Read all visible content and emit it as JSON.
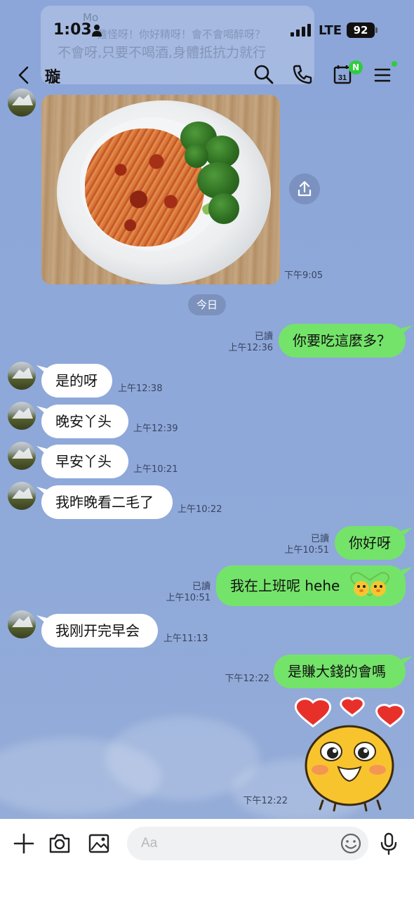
{
  "status_bar": {
    "time": "1:03",
    "network": "LTE",
    "battery": "92"
  },
  "notification_ghost": {
    "sender": "Mo",
    "line1": "難怪呀！你好精呀！會不會喝醉呀？",
    "line2": "不會呀,只要不喝酒,身體抵抗力就行"
  },
  "header": {
    "title": "璇",
    "calendar_day": "31",
    "calendar_badge": "N"
  },
  "photo_message": {
    "time": "下午9:05"
  },
  "date_divider": "今日",
  "messages": [
    {
      "side": "out",
      "text": "你要吃這麼多？",
      "read": "已讀",
      "time": "上午12:36"
    },
    {
      "side": "in",
      "text": "是的呀",
      "time": "上午12:38"
    },
    {
      "side": "in",
      "text": "晚安丫头",
      "time": "上午12:39"
    },
    {
      "side": "in",
      "text": "早安丫头",
      "time": "上午10:21"
    },
    {
      "side": "in",
      "text": "我昨晚看二毛了",
      "time": "上午10:22"
    },
    {
      "side": "out",
      "text": "你好呀",
      "read": "已讀",
      "time": "上午10:51"
    },
    {
      "side": "out",
      "text": "我在上班呢 hehe",
      "read": "已讀",
      "time": "上午10:51"
    },
    {
      "side": "in",
      "text": "我刚开完早会",
      "time": "上午11:13"
    },
    {
      "side": "out",
      "text": "是賺大錢的會嗎",
      "time": "下午12:22"
    }
  ],
  "sticker_message": {
    "time": "下午12:22"
  },
  "input": {
    "placeholder": "Aa",
    "value": ""
  },
  "colors": {
    "chat_bg": "#8fa8d8",
    "outgoing_bubble": "#74e36a",
    "incoming_bubble": "#ffffff",
    "badge_green": "#2ecc40"
  },
  "icons": [
    "back-icon",
    "search-icon",
    "phone-icon",
    "calendar-icon",
    "menu-icon",
    "share-icon",
    "plus-icon",
    "camera-icon",
    "image-icon",
    "emoji-icon",
    "mic-icon"
  ]
}
